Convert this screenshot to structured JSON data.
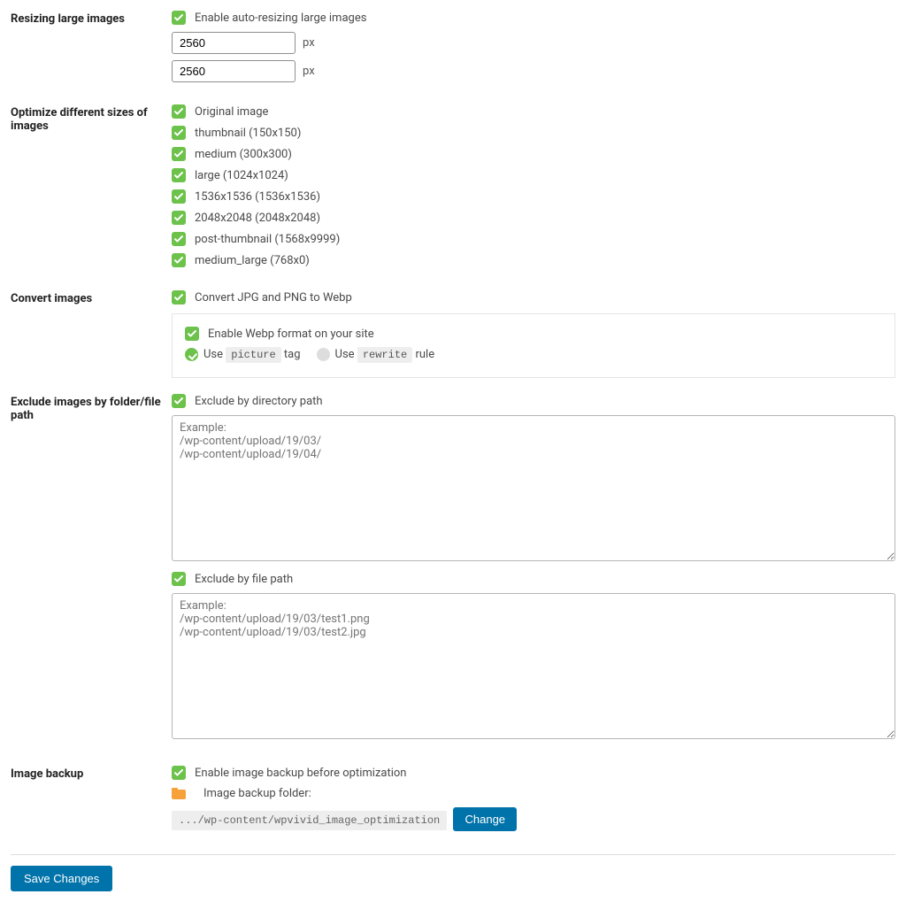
{
  "sections": {
    "resize": {
      "label": "Resizing large images",
      "checkbox_label": "Enable auto-resizing large images",
      "width": "2560",
      "height": "2560",
      "unit": "px"
    },
    "sizes": {
      "label": "Optimize different sizes of images",
      "options": [
        "Original image",
        "thumbnail (150x150)",
        "medium (300x300)",
        "large (1024x1024)",
        "1536x1536 (1536x1536)",
        "2048x2048 (2048x2048)",
        "post-thumbnail (1568x9999)",
        "medium_large (768x0)"
      ]
    },
    "convert": {
      "label": "Convert images",
      "checkbox_label": "Convert JPG and PNG to Webp",
      "enable_label": "Enable Webp format on your site",
      "use1": "Use ",
      "picture_tag": "picture",
      "tag_suffix": " tag",
      "use2": "Use ",
      "rewrite_tag": "rewrite",
      "rule_suffix": " rule"
    },
    "exclude": {
      "label": "Exclude images by folder/file path",
      "dir_label": "Exclude by directory path",
      "dir_placeholder": "Example:\n/wp-content/upload/19/03/\n/wp-content/upload/19/04/",
      "file_label": "Exclude by file path",
      "file_placeholder": "Example:\n/wp-content/upload/19/03/test1.png\n/wp-content/upload/19/03/test2.jpg"
    },
    "backup": {
      "label": "Image backup",
      "checkbox_label": "Enable image backup before optimization",
      "folder_label": "Image backup folder:",
      "path": ".../wp-content/wpvivid_image_optimization",
      "change_btn": "Change"
    }
  },
  "save_btn": "Save Changes"
}
